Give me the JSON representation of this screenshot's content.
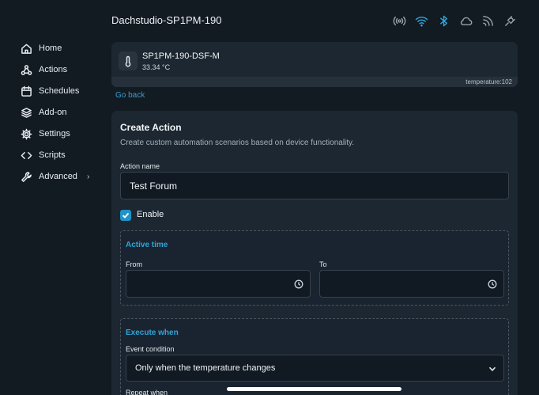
{
  "header": {
    "device_title": "Dachstudio-SP1PM-190",
    "status_icons": [
      "radio-waves-icon",
      "wifi-icon",
      "bluetooth-icon",
      "cloud-icon",
      "rss-feed-icon",
      "plug-icon"
    ]
  },
  "sidebar": {
    "items": [
      {
        "label": "Home",
        "icon": "home-icon"
      },
      {
        "label": "Actions",
        "icon": "webhook-icon"
      },
      {
        "label": "Schedules",
        "icon": "calendar-icon"
      },
      {
        "label": "Add-on",
        "icon": "layers-icon"
      },
      {
        "label": "Settings",
        "icon": "gear-icon"
      },
      {
        "label": "Scripts",
        "icon": "code-icon"
      },
      {
        "label": "Advanced",
        "icon": "wrench-icon",
        "chevron": "›"
      }
    ]
  },
  "device_card": {
    "name": "SP1PM-190-DSF-M",
    "temperature": "33.34 °C",
    "footer": "temperature:102"
  },
  "go_back": "Go back",
  "create_action": {
    "title": "Create Action",
    "description": "Create custom automation scenarios based on device functionality.",
    "action_name_label": "Action name",
    "action_name_value": "Test Forum",
    "enable_label": "Enable",
    "enable_checked": true,
    "active_time": {
      "title": "Active time",
      "from_label": "From",
      "to_label": "To"
    },
    "execute_when": {
      "title": "Execute when",
      "event_condition_label": "Event condition",
      "event_condition_value": "Only when the temperature changes",
      "repeat_label": "Repeat when"
    }
  },
  "colors": {
    "background": "#121a22",
    "panel": "#1d2731",
    "accent": "#2ea6d9"
  }
}
